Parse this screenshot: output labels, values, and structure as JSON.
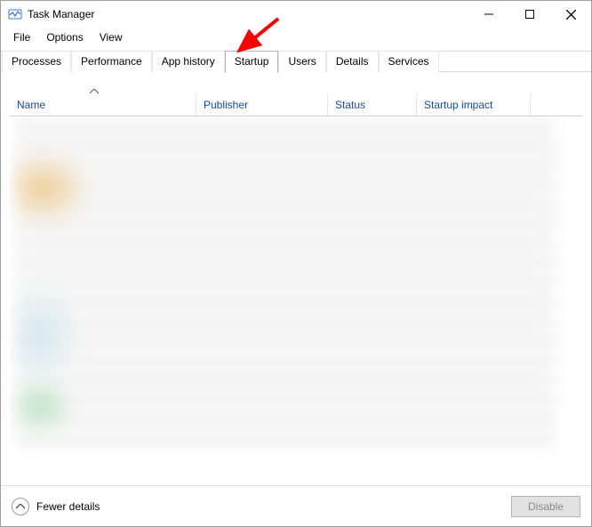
{
  "window": {
    "title": "Task Manager"
  },
  "menu": {
    "file": "File",
    "options": "Options",
    "view": "View"
  },
  "tabs": {
    "processes": "Processes",
    "performance": "Performance",
    "app_history": "App history",
    "startup": "Startup",
    "users": "Users",
    "details": "Details",
    "services": "Services",
    "active": "startup"
  },
  "columns": {
    "name": "Name",
    "publisher": "Publisher",
    "status": "Status",
    "startup_impact": "Startup impact",
    "sorted_by": "name",
    "sort_dir": "asc"
  },
  "footer": {
    "fewer_details": "Fewer details",
    "disable": "Disable",
    "disable_enabled": false
  },
  "annotation": {
    "arrow_target": "tab-startup",
    "arrow_color": "#ff0000"
  }
}
